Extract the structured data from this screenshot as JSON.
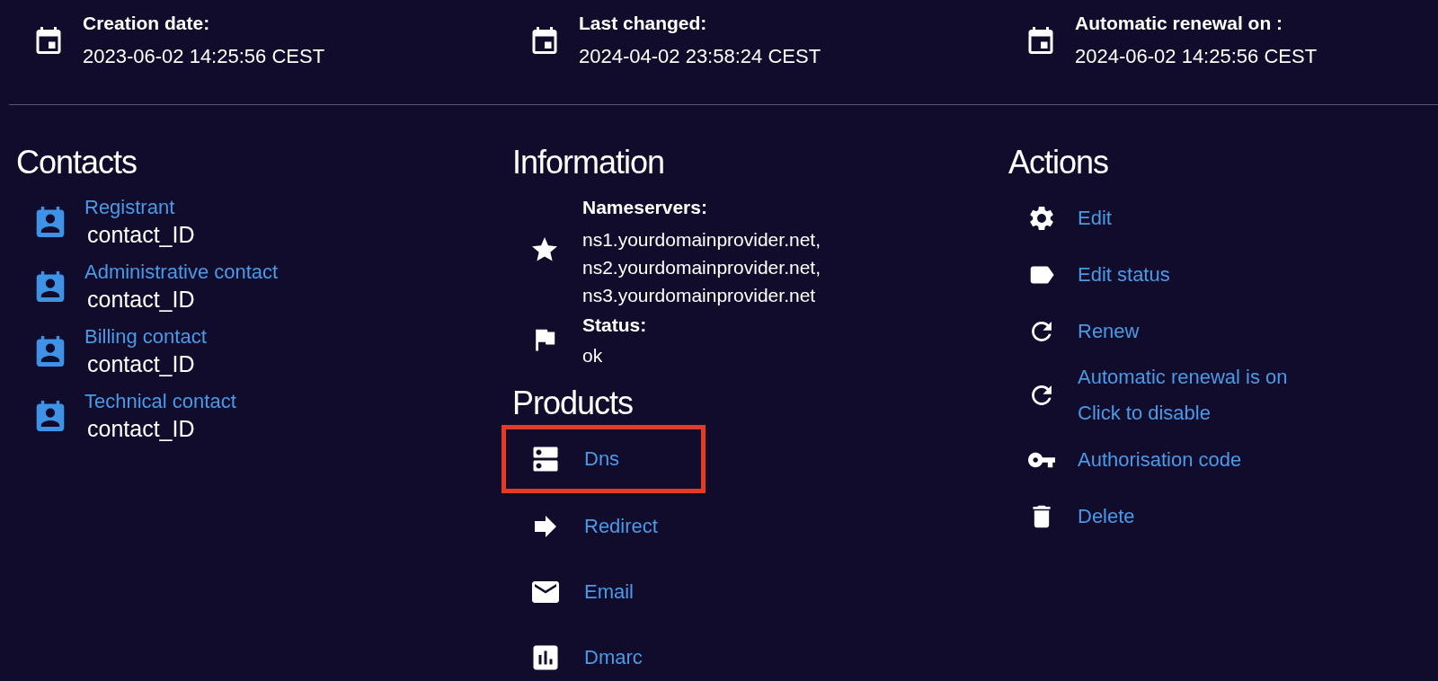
{
  "dates": [
    {
      "label": "Creation date:",
      "value": "2023-06-02 14:25:56 CEST"
    },
    {
      "label": "Last changed:",
      "value": "2024-04-02 23:58:24 CEST"
    },
    {
      "label": "Automatic renewal on :",
      "value": "2024-06-02 14:25:56 CEST"
    }
  ],
  "contacts": {
    "title": "Contacts",
    "items": [
      {
        "role": "Registrant",
        "id": "contact_ID"
      },
      {
        "role": "Administrative contact",
        "id": "contact_ID"
      },
      {
        "role": "Billing contact",
        "id": "contact_ID"
      },
      {
        "role": "Technical contact",
        "id": "contact_ID"
      }
    ]
  },
  "information": {
    "title": "Information",
    "items": [
      {
        "label": "Nameservers:",
        "lines": [
          "ns1.yourdomainprovider.net,",
          "ns2.yourdomainprovider.net,",
          "ns3.yourdomainprovider.net"
        ]
      },
      {
        "label": "Status:",
        "lines": [
          "ok"
        ]
      }
    ]
  },
  "products": {
    "title": "Products",
    "items": [
      {
        "label": "Dns",
        "highlighted": true
      },
      {
        "label": "Redirect",
        "highlighted": false
      },
      {
        "label": "Email",
        "highlighted": false
      },
      {
        "label": "Dmarc",
        "highlighted": false
      }
    ]
  },
  "actions": {
    "title": "Actions",
    "items": [
      {
        "lines": [
          "Edit"
        ]
      },
      {
        "lines": [
          "Edit status"
        ]
      },
      {
        "lines": [
          "Renew"
        ]
      },
      {
        "lines": [
          "Automatic renewal is on",
          "Click to disable"
        ]
      },
      {
        "lines": [
          "Authorisation code"
        ]
      },
      {
        "lines": [
          "Delete"
        ]
      }
    ]
  }
}
